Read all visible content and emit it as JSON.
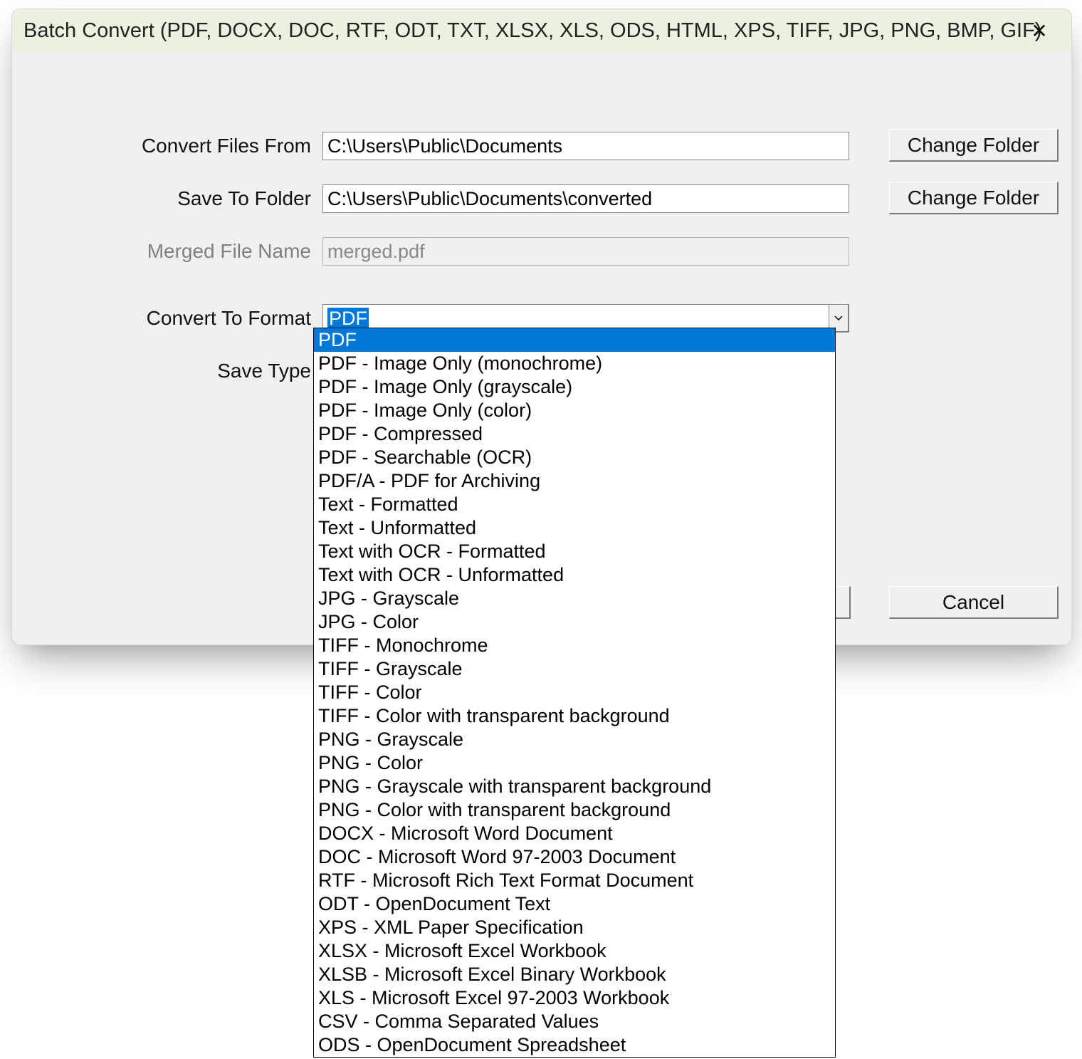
{
  "title": "Batch Convert (PDF, DOCX, DOC, RTF, ODT, TXT, XLSX, XLS, ODS, HTML, XPS, TIFF, JPG, PNG, BMP, GIF)",
  "labels": {
    "from": "Convert Files From",
    "to": "Save To Folder",
    "merged": "Merged File Name",
    "format": "Convert To Format",
    "savetype": "Save Type"
  },
  "fields": {
    "from": "C:\\Users\\Public\\Documents",
    "to": "C:\\Users\\Public\\Documents\\converted",
    "merged": "merged.pdf",
    "format_selected": "PDF"
  },
  "buttons": {
    "change_folder": "Change Folder",
    "cancel": "Cancel"
  },
  "format_options": [
    "PDF",
    "PDF - Image Only (monochrome)",
    "PDF - Image Only (grayscale)",
    "PDF - Image Only (color)",
    "PDF - Compressed",
    "PDF - Searchable (OCR)",
    "PDF/A - PDF for Archiving",
    "Text - Formatted",
    "Text - Unformatted",
    "Text with OCR - Formatted",
    "Text with OCR - Unformatted",
    "JPG - Grayscale",
    "JPG - Color",
    "TIFF - Monochrome",
    "TIFF - Grayscale",
    "TIFF - Color",
    "TIFF - Color with transparent background",
    "PNG - Grayscale",
    "PNG - Color",
    "PNG - Grayscale with transparent background",
    "PNG - Color with transparent background",
    "DOCX - Microsoft Word Document",
    "DOC - Microsoft Word 97-2003 Document",
    "RTF - Microsoft Rich Text Format Document",
    "ODT - OpenDocument Text",
    "XPS - XML Paper Specification",
    "XLSX - Microsoft Excel Workbook",
    "XLSB - Microsoft Excel Binary Workbook",
    "XLS - Microsoft Excel 97-2003 Workbook",
    "CSV - Comma Separated Values",
    "ODS - OpenDocument Spreadsheet"
  ]
}
